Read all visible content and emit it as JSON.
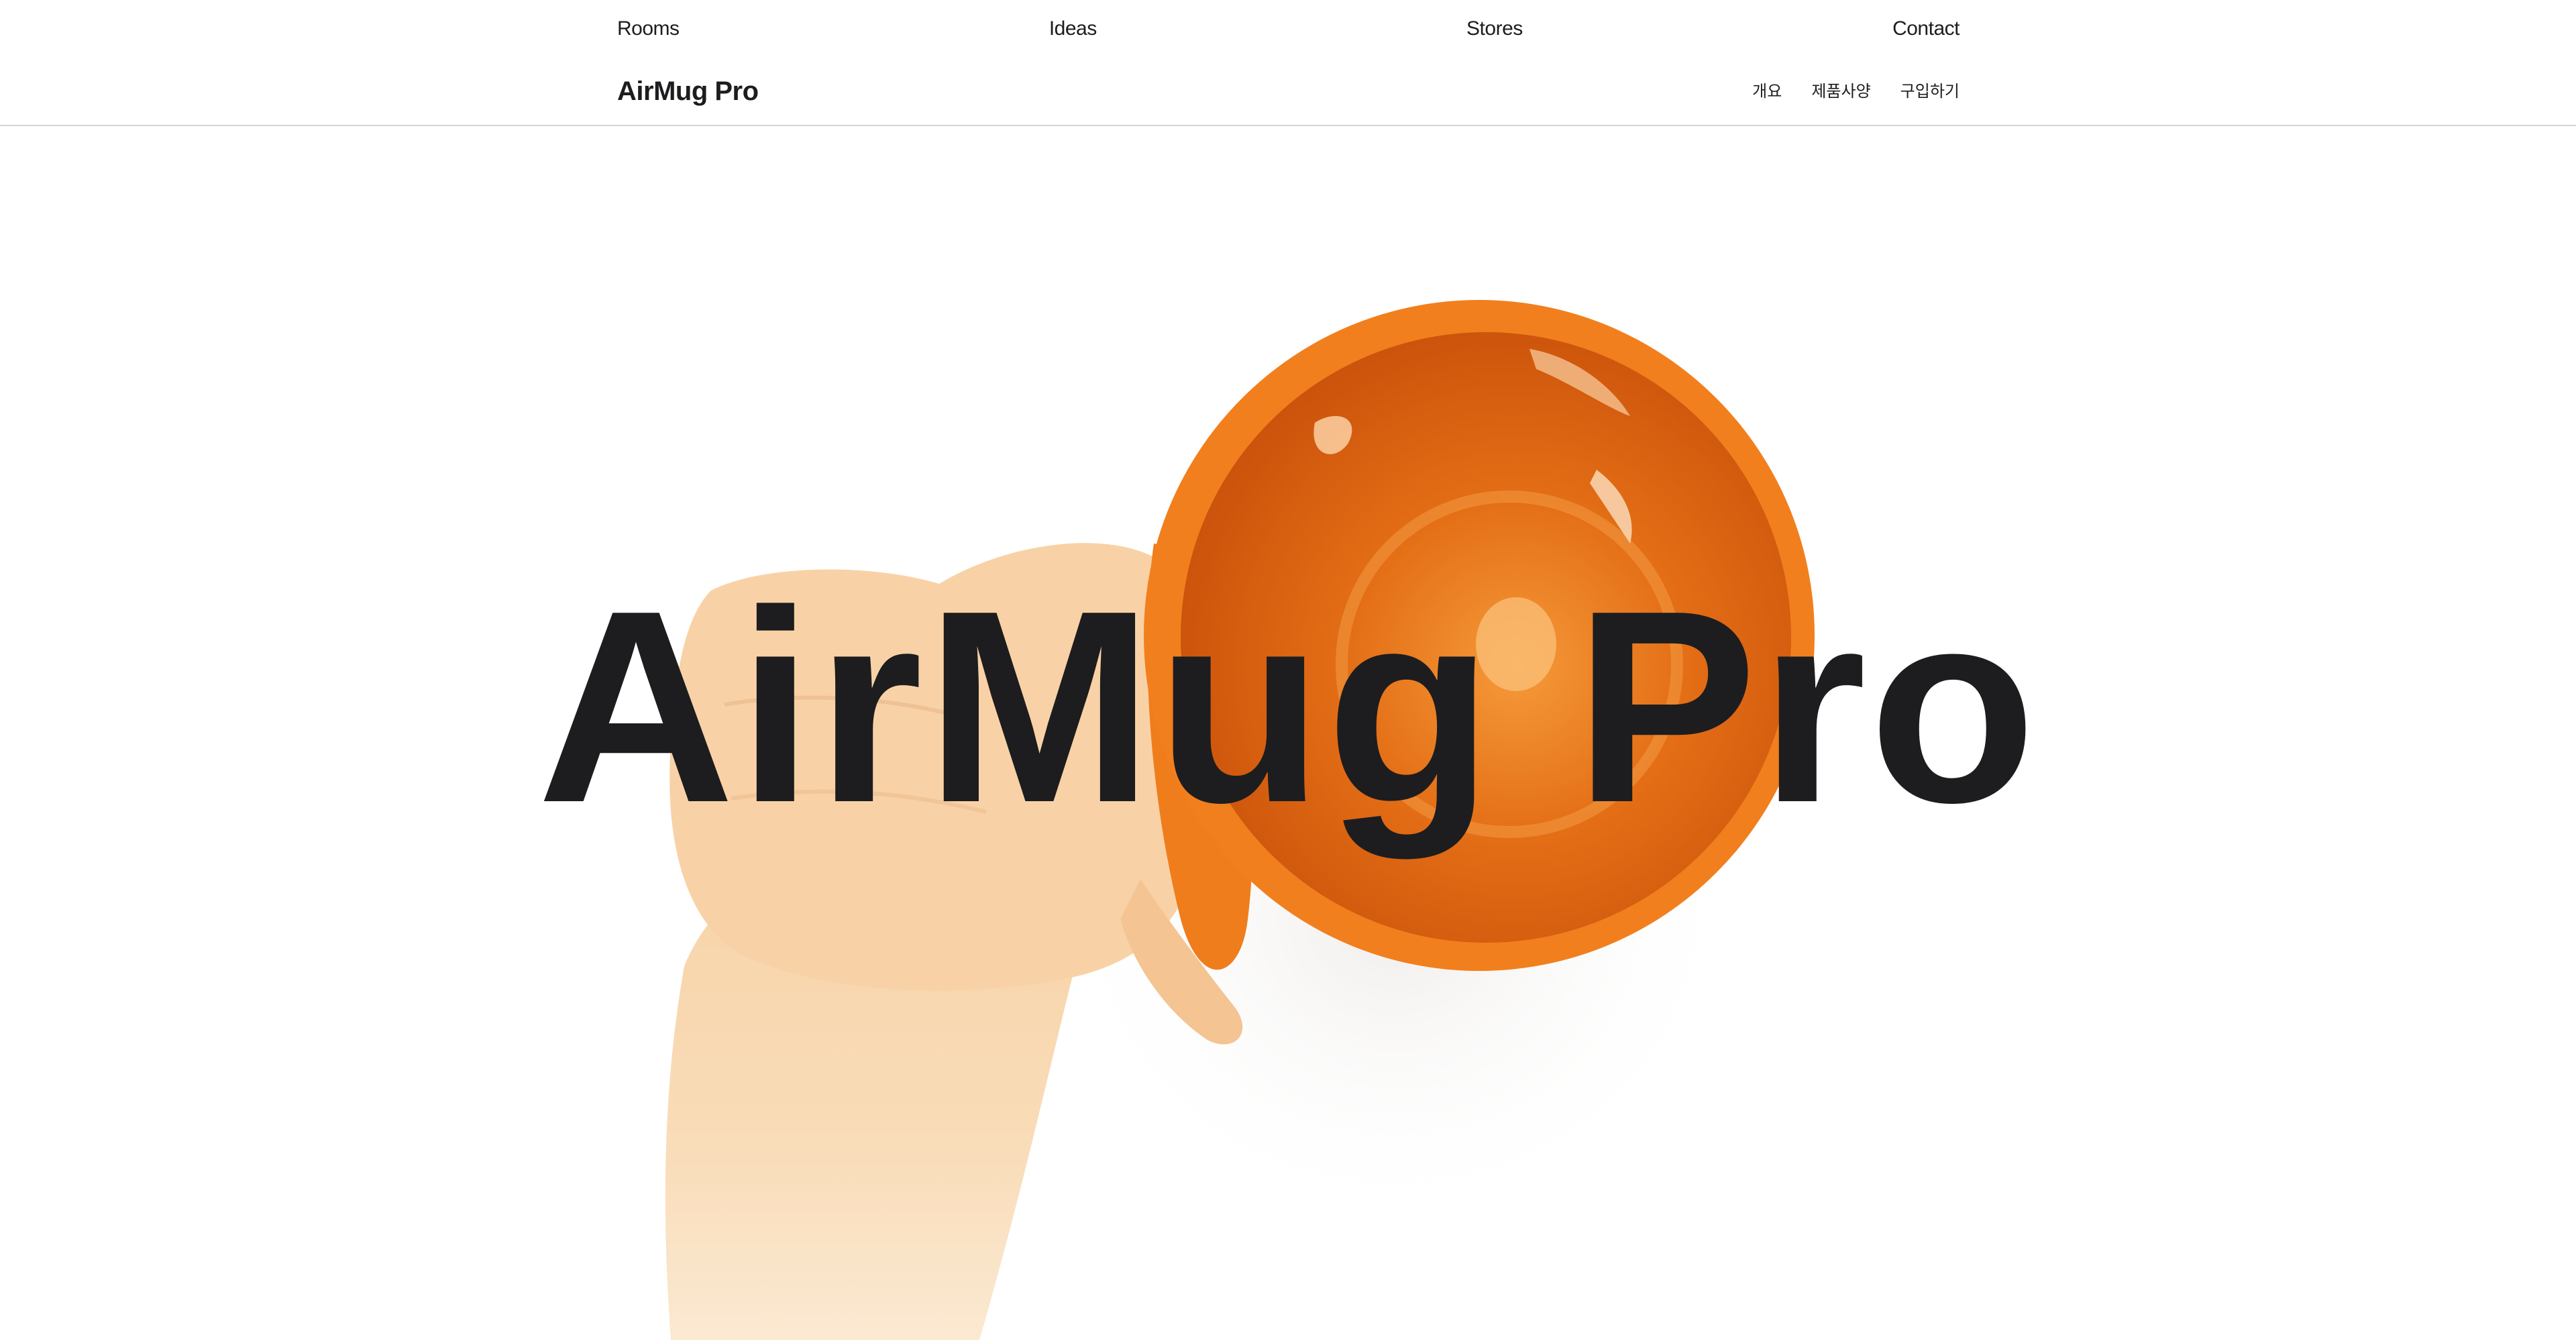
{
  "global_nav": {
    "items": [
      {
        "label": "Rooms"
      },
      {
        "label": "Ideas"
      },
      {
        "label": "Stores"
      },
      {
        "label": "Contact"
      }
    ]
  },
  "local_nav": {
    "product_name": "AirMug Pro",
    "links": [
      {
        "label": "개요"
      },
      {
        "label": "제품사양"
      },
      {
        "label": "구입하기"
      }
    ]
  },
  "hero": {
    "title": "AirMug Pro",
    "image": "hand-holding-orange-mug"
  },
  "colors": {
    "text": "#1d1d1f",
    "mug_orange": "#f07a1a",
    "mug_inner": "#d4570c",
    "skin": "#f6cfa2",
    "divider": "#d5d5d5"
  }
}
